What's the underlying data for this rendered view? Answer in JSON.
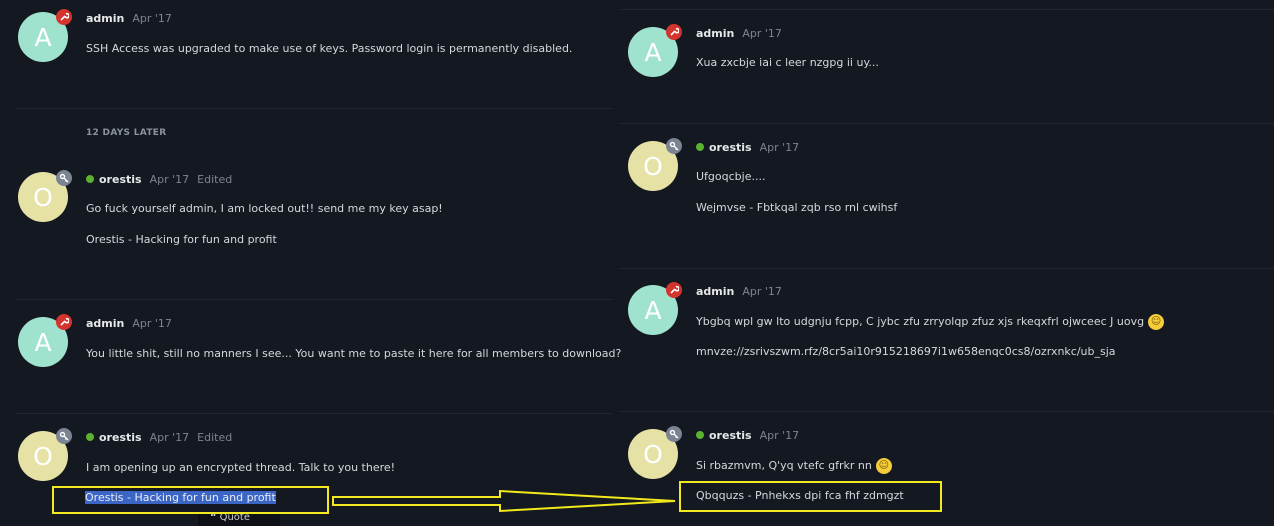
{
  "left": {
    "posts": [
      {
        "user": "admin",
        "avatar": "A",
        "date": "Apr '17",
        "edited": "",
        "online": false,
        "lines": [
          "SSH Access was upgraded to make use of keys. Password login is permanently disabled."
        ]
      },
      {
        "user": "orestis",
        "avatar": "O",
        "date": "Apr '17",
        "edited": "Edited",
        "online": true,
        "lines": [
          "Go fuck yourself admin, I am locked out!! send me my key asap!",
          "Orestis - Hacking for fun and profit"
        ]
      },
      {
        "user": "admin",
        "avatar": "A",
        "date": "Apr '17",
        "edited": "",
        "online": false,
        "lines": [
          "You little shit, still no manners I see... You want me to paste it here for all members to download?"
        ]
      },
      {
        "user": "orestis",
        "avatar": "O",
        "date": "Apr '17",
        "edited": "Edited",
        "online": true,
        "lines": [
          "I am opening up an encrypted thread. Talk to you there!",
          "Orestis - Hacking for fun and profit"
        ]
      }
    ],
    "time_gap": "12 DAYS LATER",
    "quote_label": "Quote"
  },
  "right": {
    "posts": [
      {
        "user": "admin",
        "avatar": "A",
        "date": "Apr '17",
        "online": false,
        "lines": [
          "Xua zxcbje iai c leer nzgpg ii uy..."
        ]
      },
      {
        "user": "orestis",
        "avatar": "O",
        "date": "Apr '17",
        "online": true,
        "lines": [
          "Ufgoqcbje....",
          "Wejmvse - Fbtkqal zqb rso rnl cwihsf"
        ]
      },
      {
        "user": "admin",
        "avatar": "A",
        "date": "Apr '17",
        "online": false,
        "lines": [
          "Ybgbq wpl gw lto udgnju fcpp, C jybc zfu zrryolqp zfuz xjs rkeqxfrl ojwceec J uovg",
          "mnvze://zsrivszwm.rfz/8cr5ai10r915218697i1w658enqc0cs8/ozrxnkc/ub_sja"
        ]
      },
      {
        "user": "orestis",
        "avatar": "O",
        "date": "Apr '17",
        "online": true,
        "lines": [
          "Si rbazmvm, Q'yq vtefc gfrkr nn",
          "Qbqquzs - Pnhekxs dpi fca fhf zdmgzt"
        ]
      }
    ]
  },
  "colors": {
    "highlight_box": "#f2ea1c",
    "admin_badge": "#d3342d",
    "user_badge": "#7b8492",
    "online": "#5cb22f"
  },
  "icons": {
    "admin_badge": "wrench-icon",
    "user_badge": "key-icon",
    "emoji_smile": "smile-emoji-icon",
    "emoji_wink": "wink-emoji-icon",
    "quote": "quote-icon"
  }
}
